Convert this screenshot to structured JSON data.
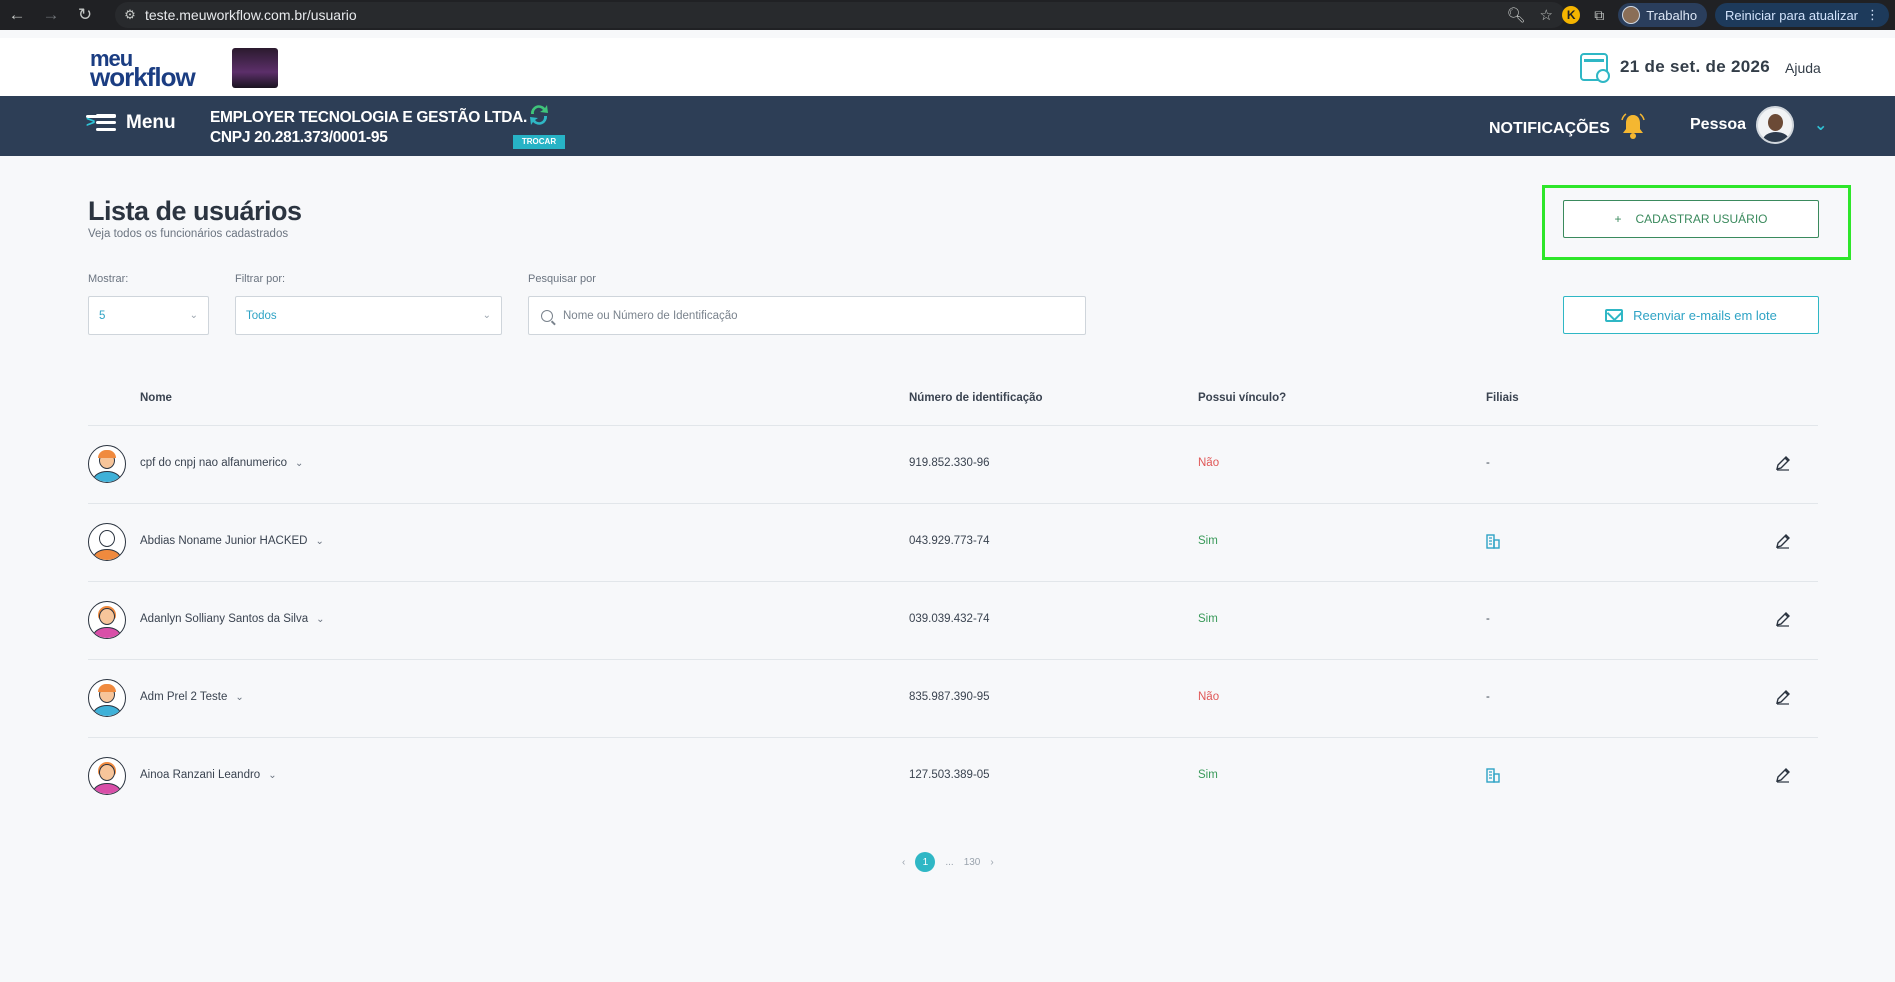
{
  "browser": {
    "url": "teste.meuworkflow.com.br/usuario",
    "profile_label": "Trabalho",
    "update_label": "Reiniciar para atualizar"
  },
  "header": {
    "logo_line1": "meu",
    "logo_line2": "workflow",
    "date": "21 de set. de 2026",
    "help": "Ajuda"
  },
  "nav": {
    "menu_label": "Menu",
    "company_name": "EMPLOYER TECNOLOGIA E GESTÃO LTDA.",
    "company_cnpj": "CNPJ 20.281.373/0001-95",
    "switch_label": "TROCAR",
    "notifications_label": "NOTIFICAÇÕES",
    "user_label": "Pessoa"
  },
  "page": {
    "title": "Lista de usuários",
    "subtitle": "Veja todos os funcionários cadastrados",
    "register_button": "CADASTRAR USUÁRIO",
    "register_plus": "+",
    "resend_button": "Reenviar e-mails em lote"
  },
  "filters": {
    "show_label": "Mostrar:",
    "show_value": "5",
    "filter_label": "Filtrar por:",
    "filter_value": "Todos",
    "search_label": "Pesquisar por",
    "search_placeholder": "Nome ou Número de Identificação"
  },
  "table": {
    "headers": {
      "name": "Nome",
      "id_number": "Número de identificação",
      "has_link": "Possui vínculo?",
      "branches": "Filiais"
    },
    "rows": [
      {
        "name": "cpf do cnpj nao alfanumerico",
        "id_number": "919.852.330-96",
        "has_link": "Não",
        "branches": "-",
        "avatar": "male"
      },
      {
        "name": "Abdias Noname Junior HACKED",
        "id_number": "043.929.773-74",
        "has_link": "Sim",
        "branches": "",
        "avatar": "neutral"
      },
      {
        "name": "Adanlyn Solliany Santos da Silva",
        "id_number": "039.039.432-74",
        "has_link": "Sim",
        "branches": "-",
        "avatar": "female"
      },
      {
        "name": "Adm Prel 2 Teste",
        "id_number": "835.987.390-95",
        "has_link": "Não",
        "branches": "-",
        "avatar": "male"
      },
      {
        "name": "Ainoa Ranzani Leandro",
        "id_number": "127.503.389-05",
        "has_link": "Sim",
        "branches": "",
        "avatar": "female"
      }
    ]
  },
  "pagination": {
    "prev": "‹",
    "current": "1",
    "ellipsis": "...",
    "last": "130",
    "next": "›"
  },
  "colors": {
    "nav_bg": "#2d3e56",
    "accent": "#2fb7c5",
    "highlight": "#2ee62a",
    "yes": "#3a9a5a",
    "no": "#e05757"
  }
}
